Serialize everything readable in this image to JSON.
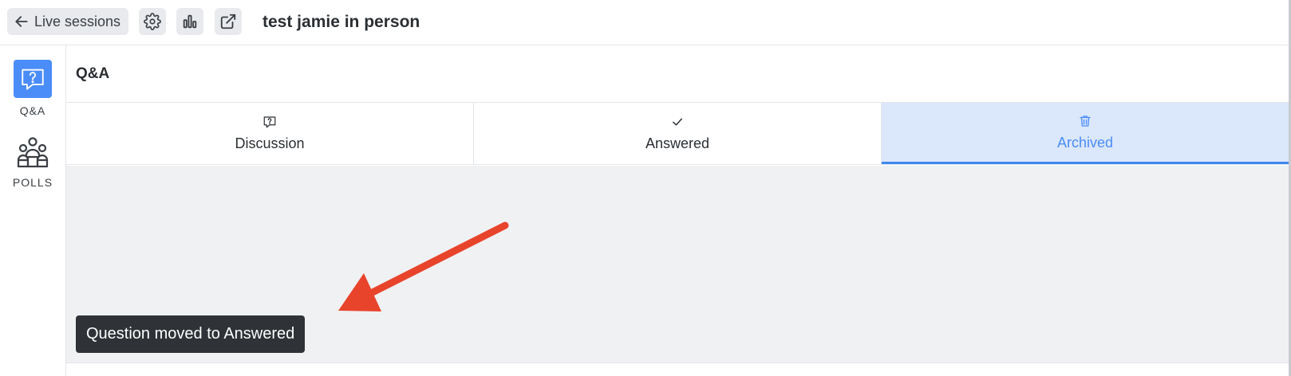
{
  "topbar": {
    "back_label": "Live sessions",
    "session_title": "test jamie in person",
    "icons": [
      "arrow-left-icon",
      "gear-icon",
      "bar-chart-icon",
      "external-link-icon"
    ]
  },
  "sidebar": {
    "items": [
      {
        "label": "Q&A",
        "icon": "question-chat-icon",
        "active": true
      },
      {
        "label": "POLLS",
        "icon": "people-group-icon",
        "active": false
      }
    ]
  },
  "main": {
    "section_title": "Q&A",
    "tabs": [
      {
        "label": "Discussion",
        "icon": "question-chat-icon",
        "active": false
      },
      {
        "label": "Answered",
        "icon": "check-icon",
        "active": false
      },
      {
        "label": "Archived",
        "icon": "trash-icon",
        "active": true
      }
    ]
  },
  "toast": {
    "message": "Question moved to Answered"
  },
  "colors": {
    "accent": "#4b8df8",
    "active_tab_bg": "#dbe7fb",
    "content_bg": "#f0f1f3",
    "toast_bg": "#2f3337",
    "annotation_arrow": "#e8442c"
  }
}
